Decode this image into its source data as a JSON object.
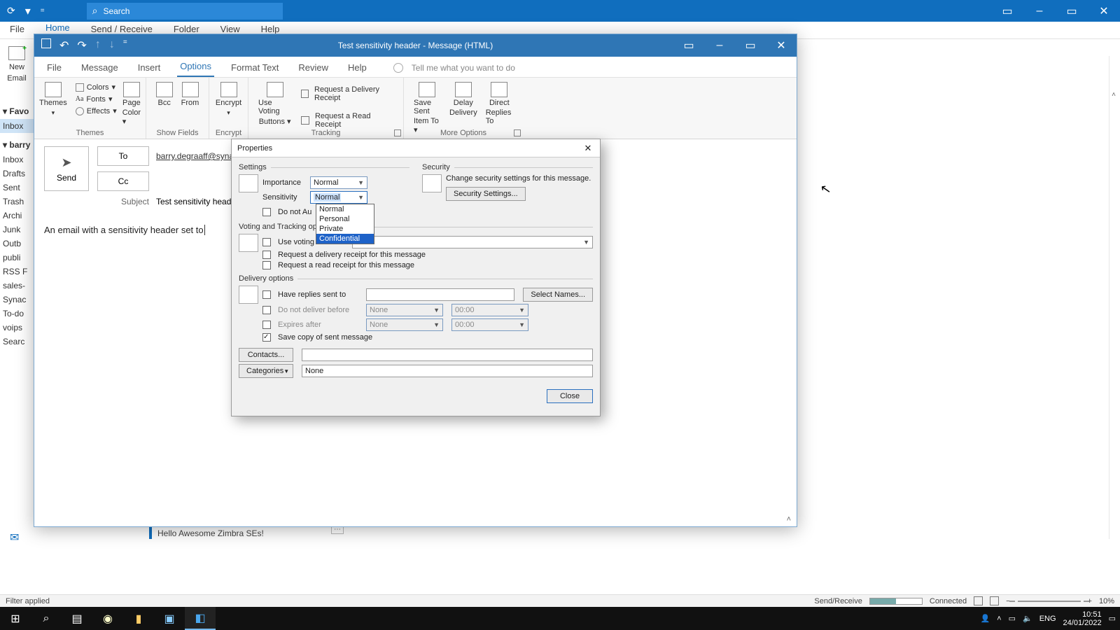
{
  "app": {
    "search_placeholder": "Search",
    "menubar": [
      "File",
      "Home",
      "Send / Receive",
      "Folder",
      "View",
      "Help"
    ],
    "new_email_label": "New\nEmail",
    "new_email_line1": "New",
    "new_email_line2": "Email",
    "nav_groups": [
      {
        "label": "Favo",
        "items": [
          "Inbox"
        ]
      },
      {
        "label": "barry",
        "items": [
          "Inbox",
          "Drafts",
          "Sent",
          "Trash",
          "Archi",
          "Junk",
          "Outb",
          "publi",
          "RSS F",
          "sales-",
          "Synac",
          "To-do",
          "voips",
          "Searc"
        ]
      }
    ],
    "selected_nav": "Inbox",
    "snippet": "Hello Awesome Zimbra SEs!",
    "status_left": "Filter applied",
    "status_sendreceive": "Send/Receive",
    "status_connected": "Connected",
    "status_zoom": "10%"
  },
  "msg": {
    "title": "Test sensitivity header  -  Message (HTML)",
    "tabs": [
      "File",
      "Message",
      "Insert",
      "Options",
      "Format Text",
      "Review",
      "Help"
    ],
    "active_tab": "Options",
    "tellme": "Tell me what you want to do",
    "ribbon": {
      "themes": {
        "label": "Themes",
        "btn": "Themes",
        "colors": "Colors",
        "fonts": "Fonts",
        "effects": "Effects",
        "pagecolor": "Page\nColor",
        "pagecolor1": "Page",
        "pagecolor2": "Color"
      },
      "showfields": {
        "label": "Show Fields",
        "bcc": "Bcc",
        "from": "From"
      },
      "encrypt": {
        "label": "Encrypt",
        "btn": "Encrypt"
      },
      "tracking": {
        "label": "Tracking",
        "voting": "Use Voting\nButtons",
        "voting1": "Use Voting",
        "voting2": "Buttons",
        "delivery": "Request a Delivery Receipt",
        "read": "Request a Read Receipt"
      },
      "more": {
        "label": "More Options",
        "save": "Save Sent\nItem To",
        "save1": "Save Sent",
        "save2": "Item To",
        "delay": "Delay\nDelivery",
        "delay1": "Delay",
        "delay2": "Delivery",
        "direct": "Direct\nReplies To",
        "direct1": "Direct",
        "direct2": "Replies To"
      }
    },
    "send": "Send",
    "to": "To",
    "cc": "Cc",
    "to_value": "barry.degraaff@synacor",
    "subject_label": "Subject",
    "subject_value": "Test sensitivity header",
    "body": "An email with a sensitivity header set to "
  },
  "props": {
    "title": "Properties",
    "settings": "Settings",
    "security": "Security",
    "importance": "Importance",
    "importance_value": "Normal",
    "sensitivity": "Sensitivity",
    "sensitivity_value": "Normal",
    "sensitivity_options": [
      "Normal",
      "Personal",
      "Private",
      "Confidential"
    ],
    "sensitivity_hover": "Confidential",
    "do_not_auto": "Do not Au",
    "security_text": "Change security settings for this message.",
    "security_btn": "Security Settings...",
    "voting_section": "Voting and Tracking op",
    "use_voting": "Use voting buttons",
    "req_delivery": "Request a delivery receipt for this message",
    "req_read": "Request a read receipt for this message",
    "delivery_section": "Delivery options",
    "have_replies": "Have replies sent to",
    "select_names": "Select Names...",
    "no_deliver_before": "Do not deliver before",
    "expires_after": "Expires after",
    "none": "None",
    "time": "00:00",
    "save_copy": "Save copy of sent message",
    "contacts": "Contacts...",
    "categories": "Categories",
    "categories_value": "None",
    "close": "Close"
  },
  "taskbar": {
    "lang": "ENG",
    "time": "10:51",
    "date": "24/01/2022"
  }
}
